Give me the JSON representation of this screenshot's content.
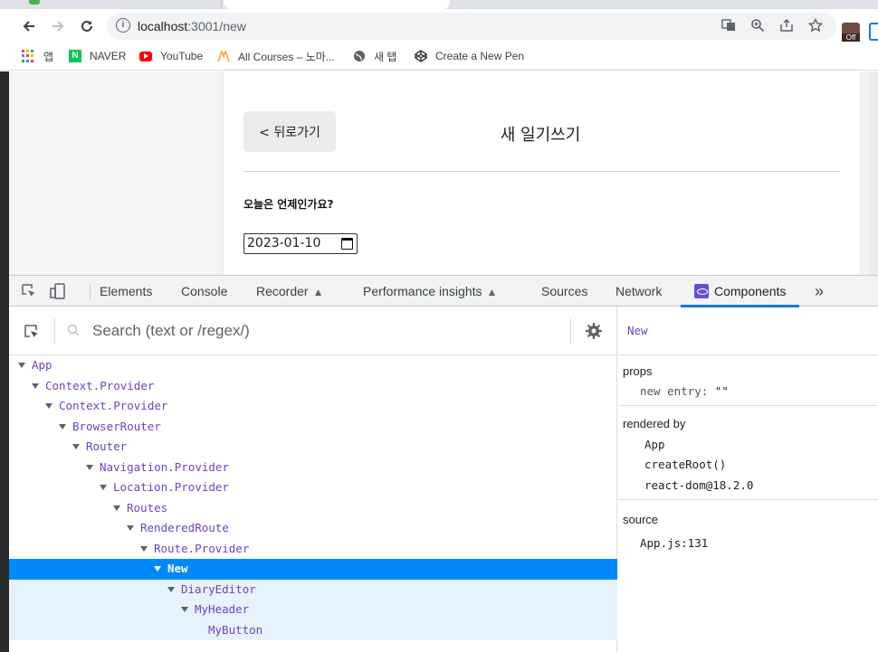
{
  "browser": {
    "url_host": "localhost",
    "url_rest": ":3001/new",
    "bookmarks": [
      {
        "label": "앱"
      },
      {
        "label": "NAVER"
      },
      {
        "label": "YouTube"
      },
      {
        "label": "All Courses – 노마..."
      },
      {
        "label": "새 탭"
      },
      {
        "label": "Create a New Pen"
      }
    ],
    "extension_badge": "Off"
  },
  "page": {
    "back_button": "< 뒤로가기",
    "header_title": "새 일기쓰기",
    "question": "오늘은 언제인가요?",
    "date_value": "2023-01-10"
  },
  "devtools": {
    "tabs": [
      "Elements",
      "Console",
      "Recorder",
      "Performance insights",
      "Sources",
      "Network",
      "Components"
    ],
    "active_tab": "Components",
    "more_tabs": "»",
    "search_placeholder": "Search (text or /regex/)",
    "tree": [
      {
        "name": "App",
        "depth": 0,
        "expanded": true
      },
      {
        "name": "Context.Provider",
        "depth": 1,
        "expanded": true
      },
      {
        "name": "Context.Provider",
        "depth": 2,
        "expanded": true
      },
      {
        "name": "BrowserRouter",
        "depth": 3,
        "expanded": true
      },
      {
        "name": "Router",
        "depth": 4,
        "expanded": true
      },
      {
        "name": "Navigation.Provider",
        "depth": 5,
        "expanded": true
      },
      {
        "name": "Location.Provider",
        "depth": 6,
        "expanded": true
      },
      {
        "name": "Routes",
        "depth": 7,
        "expanded": true
      },
      {
        "name": "RenderedRoute",
        "depth": 8,
        "expanded": true
      },
      {
        "name": "Route.Provider",
        "depth": 9,
        "expanded": true
      },
      {
        "name": "New",
        "depth": 10,
        "expanded": true,
        "selected": true
      },
      {
        "name": "DiaryEditor",
        "depth": 11,
        "expanded": true,
        "child": true
      },
      {
        "name": "MyHeader",
        "depth": 12,
        "expanded": true,
        "child": true
      },
      {
        "name": "MyButton",
        "depth": 13,
        "expanded": false,
        "child": true
      }
    ],
    "inspector": {
      "component": "New",
      "props_header": "props",
      "prop_key": "new entry:",
      "prop_value": "\"\"",
      "rendered_by_header": "rendered by",
      "rendered_by": [
        "App",
        "createRoot()",
        "react-dom@18.2.0"
      ],
      "source_header": "source",
      "source": "App.js:131"
    }
  },
  "colors": {
    "accent": "#1a73e8",
    "selected_row": "#0088fa",
    "component_name": "#6f42c1"
  }
}
